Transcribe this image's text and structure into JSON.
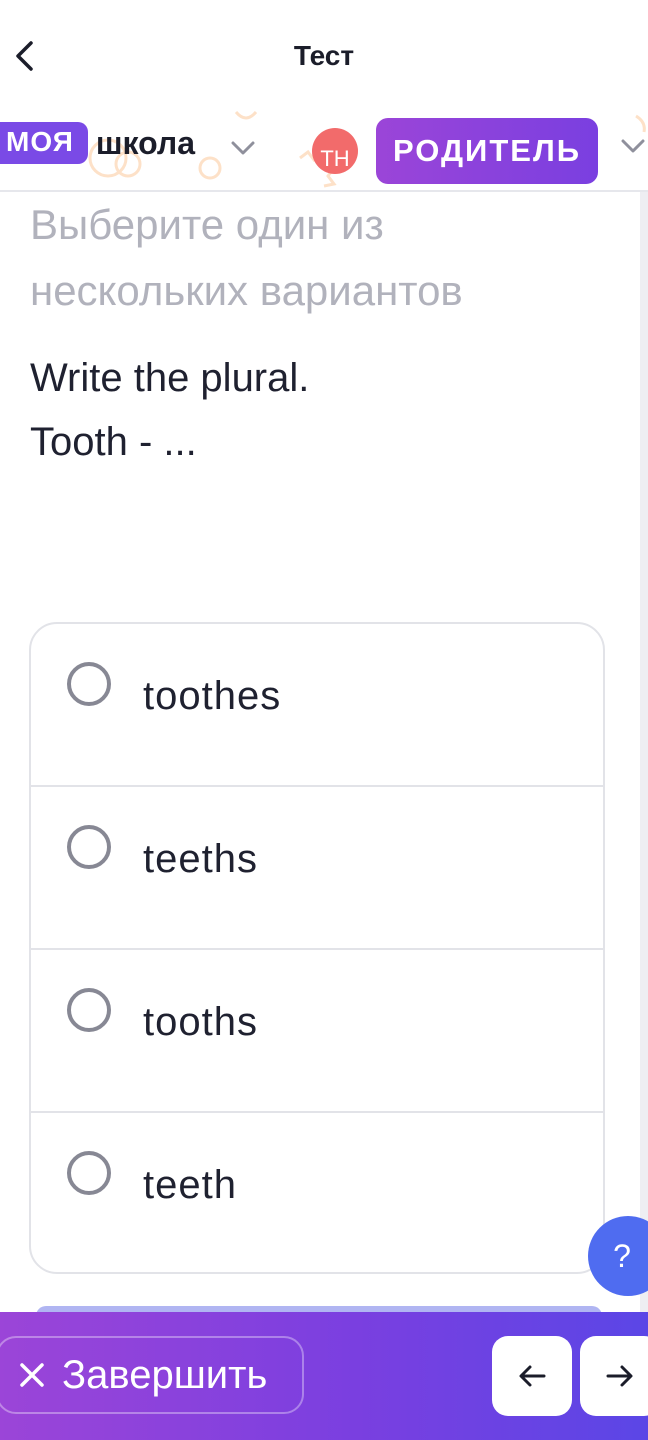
{
  "topbar": {
    "title": "Тест"
  },
  "header": {
    "brand_pill": "МОЯ",
    "brand_word": "школа",
    "avatar_initials": "ТН",
    "role_label": "РОДИТЕЛЬ"
  },
  "question": {
    "hint": "Выберите один из нескольких вариантов",
    "line1": "Write the plural.",
    "line2": "Tooth - ..."
  },
  "options": [
    {
      "label": "toothes"
    },
    {
      "label": "teeths"
    },
    {
      "label": "tooths"
    },
    {
      "label": "teeth"
    }
  ],
  "help": {
    "label": "?"
  },
  "bottom": {
    "finish_label": "Завершить",
    "prev_icon": "arrow-left-icon",
    "next_icon": "arrow-right-icon"
  },
  "colors": {
    "brand": "#7a4ae6",
    "role_gradient_start": "#9b45d8",
    "role_gradient_end": "#7a3fe0",
    "avatar": "#f26b6b",
    "help": "#4f6cf0"
  }
}
